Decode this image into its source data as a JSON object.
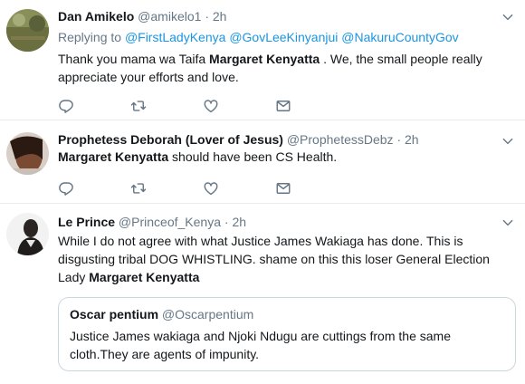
{
  "tweets": [
    {
      "name": "Dan Amikelo",
      "handle": "@amikelo1",
      "time": "2h",
      "replying_to_label": "Replying to",
      "replying_to": [
        "@FirstLadyKenya",
        "@GovLeeKinyanjui",
        "@NakuruCountyGov"
      ],
      "text_pre": "Thank you mama wa Taifa ",
      "text_bold": "Margaret Kenyatta",
      "text_post": " . We, the small people really appreciate your efforts and love."
    },
    {
      "name": "Prophetess Deborah (Lover of Jesus)",
      "handle": "@ProphetessDebz",
      "time": "2h",
      "text_bold": "Margaret Kenyatta",
      "text_post": " should have been CS Health."
    },
    {
      "name": "Le Prince",
      "handle": "@Princeof_Kenya",
      "time": "2h",
      "text_pre": "While I do not agree with what Justice James Wakiaga has done. This is disgusting tribal DOG WHISTLING. shame on this this loser General Election Lady ",
      "text_bold": "Margaret Kenyatta",
      "quote": {
        "name": "Oscar pentium",
        "handle": "@Oscarpentium",
        "text": "Justice James wakiaga and Njoki Ndugu are cuttings from the same cloth.They are agents of impunity."
      }
    }
  ],
  "dot": "·",
  "icons": [
    "reply-icon",
    "retweet-icon",
    "like-icon",
    "message-icon",
    "caret-down-icon"
  ],
  "colors": {
    "link": "#1b95e0",
    "secondary": "#657786",
    "border": "#e6ecf0"
  }
}
